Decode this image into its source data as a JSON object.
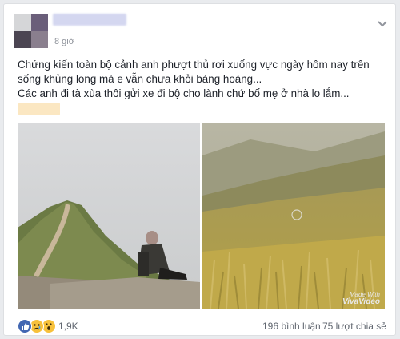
{
  "post": {
    "timestamp": "8 giờ",
    "text_lines": [
      "Chứng kiến toàn bộ cảnh anh phượt thủ rơi xuống vực ngày hôm nay trên",
      "sống khủng long mà e vẫn chưa khỏi bàng hoàng...",
      "Các anh đi tà xùa thôi gửi xe đi bộ cho lành chứ bố mẹ ở nhà lo lắm..."
    ]
  },
  "photos": {
    "photo2_watermark_line1": "Made With",
    "photo2_watermark_line2": "VivaVideo"
  },
  "footer": {
    "reaction_count": "1,9K",
    "comments": "196 bình luận",
    "shares": "75 lượt chia sẻ",
    "reaction_icons": [
      "like-icon",
      "sad-icon",
      "wow-icon"
    ]
  },
  "colors": {
    "like": "#4267b2",
    "emoji": "#f7c13b",
    "text": "#1d2129",
    "meta": "#90949c"
  }
}
